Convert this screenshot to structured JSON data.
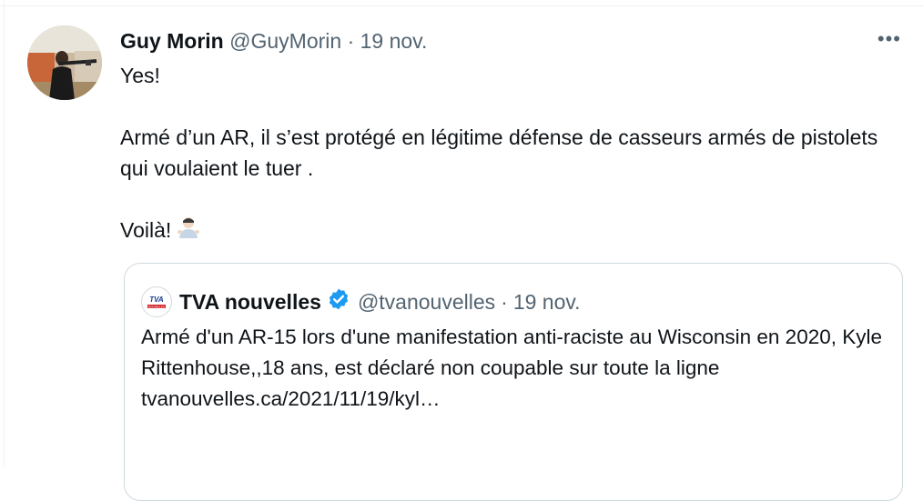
{
  "tweet": {
    "author_name": "Guy Morin",
    "author_handle": "@GuyMorin",
    "separator": "·",
    "date": "19 nov.",
    "more_label": "•••",
    "text_lines": [
      "Yes!",
      "Armé d’un AR, il s’est protégé en légitime défense de casseurs armés de pistolets qui voulaient le tuer .",
      "Voilà!"
    ]
  },
  "quoted": {
    "logo_text": "TVA",
    "logo_subtext": "NOUVELLES",
    "author_name": "TVA nouvelles",
    "author_handle": "@tvanouvelles",
    "separator": "·",
    "date": "19 nov.",
    "text": "Armé d'un AR-15 lors d'une manifestation anti-raciste au Wisconsin en 2020, Kyle Rittenhouse,,18 ans, est déclaré non coupable sur toute la ligne",
    "link": "tvanouvelles.ca/2021/11/19/kyl…"
  },
  "colors": {
    "text": "#0f1419",
    "secondary": "#536471",
    "border": "#cfd9de",
    "verified": "#1d9bf0"
  },
  "icons": [
    "more-icon",
    "verified-badge-icon",
    "shrug-emoji-icon",
    "tva-logo-icon",
    "avatar"
  ]
}
